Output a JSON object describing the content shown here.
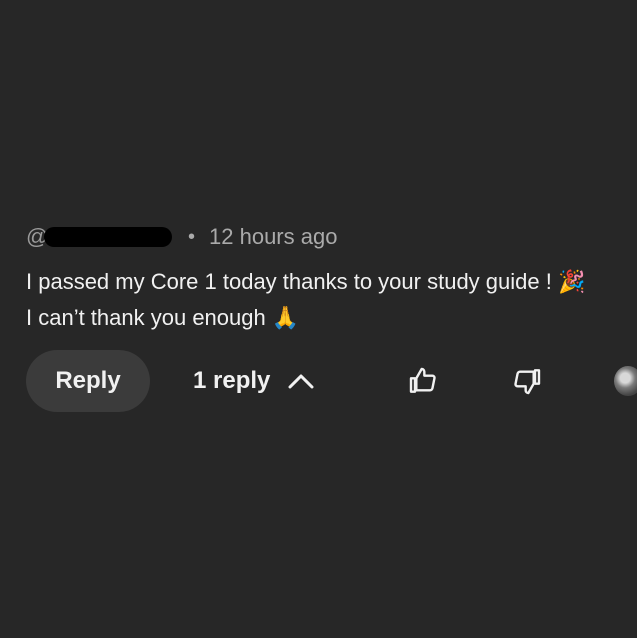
{
  "comment": {
    "handle_prefix": "@",
    "separator": "•",
    "timestamp": "12 hours ago",
    "text_line_1": "I passed my Core 1 today thanks to your study guide !",
    "text_line_1_emoji": "🎉",
    "text_line_2": "I can’t thank you enough",
    "text_line_2_emoji": "🙏"
  },
  "actions": {
    "reply_label": "Reply",
    "replies_label": "1 reply",
    "like_icon": "thumbs-up-icon",
    "dislike_icon": "thumbs-down-icon",
    "collapse_icon": "chevron-up-icon"
  },
  "colors": {
    "background": "#272727",
    "text": "#f1f1f1",
    "meta": "#aaaaaa",
    "reply_button_bg": "#3b3b3b"
  }
}
